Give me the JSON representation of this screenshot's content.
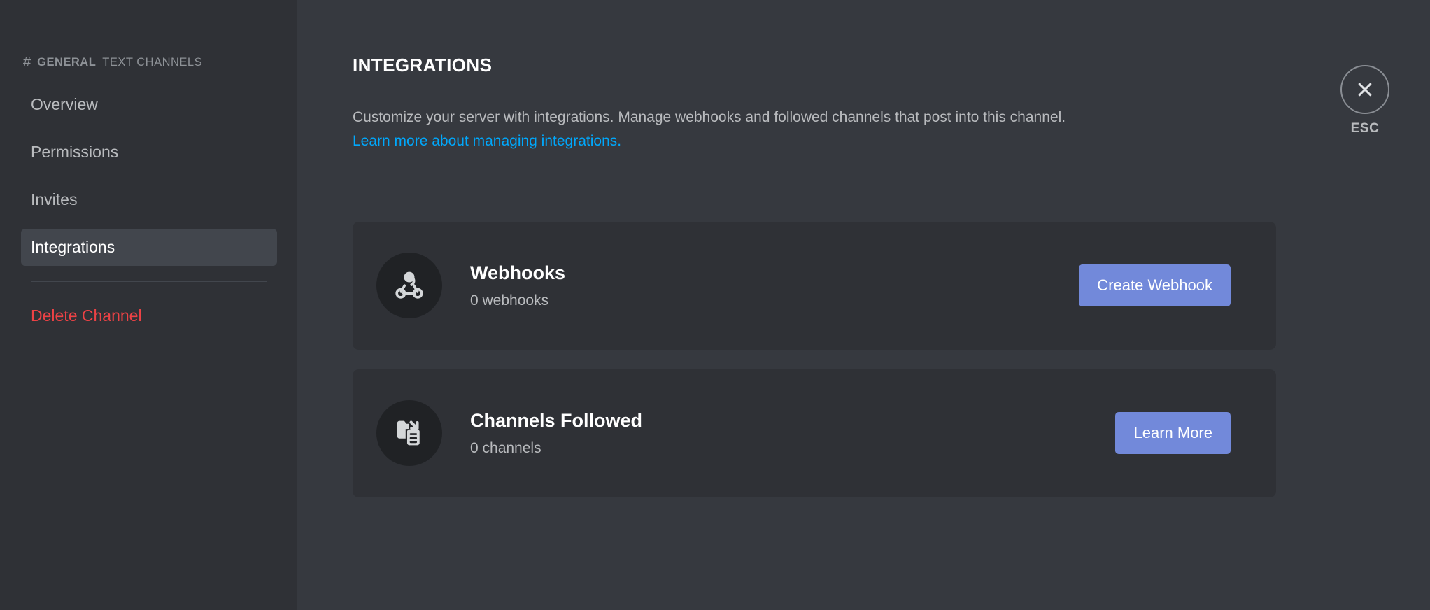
{
  "sidebar": {
    "hash_symbol": "#",
    "channel_name": "GENERAL",
    "section_label": "TEXT CHANNELS",
    "items": [
      {
        "label": "Overview",
        "active": false
      },
      {
        "label": "Permissions",
        "active": false
      },
      {
        "label": "Invites",
        "active": false
      },
      {
        "label": "Integrations",
        "active": true
      }
    ],
    "danger_item": {
      "label": "Delete Channel"
    }
  },
  "main": {
    "title": "INTEGRATIONS",
    "description": "Customize your server with integrations. Manage webhooks and followed channels that post into this channel.",
    "link_text": "Learn more about managing integrations.",
    "cards": [
      {
        "icon": "webhook-icon",
        "title": "Webhooks",
        "subtitle": "0 webhooks",
        "button_label": "Create Webhook"
      },
      {
        "icon": "channels-followed-icon",
        "title": "Channels Followed",
        "subtitle": "0 channels",
        "button_label": "Learn More"
      }
    ]
  },
  "close": {
    "icon": "close-icon",
    "label": "ESC"
  },
  "colors": {
    "sidebar_bg": "#2f3136",
    "content_bg": "#36393f",
    "card_bg": "#2f3136",
    "active_nav_bg": "#42464d",
    "accent_blurple": "#7289da",
    "link_blue": "#00a8fc",
    "danger_red": "#ed4245",
    "icon_circle_bg": "#202225",
    "text_primary": "#ffffff",
    "text_secondary": "#b9bbbe",
    "text_muted": "#8e9297"
  }
}
